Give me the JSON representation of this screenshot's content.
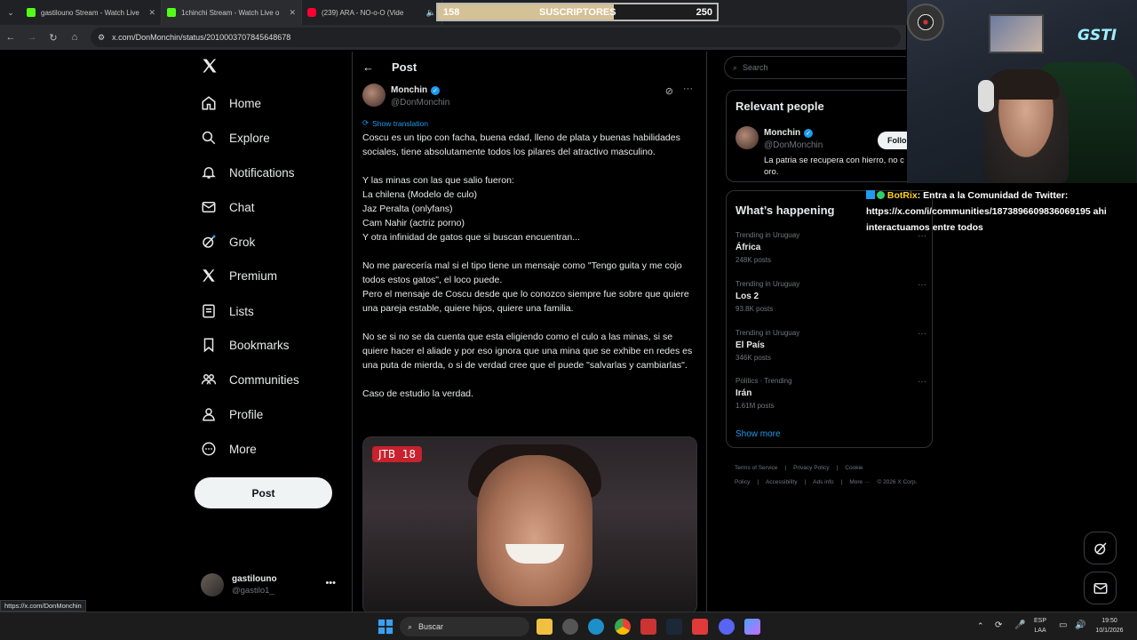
{
  "browser": {
    "tabs": [
      {
        "title": "gastilouno Stream - Watch Live",
        "icon": "kick"
      },
      {
        "title": "1chinchi Stream - Watch Live o",
        "icon": "kick"
      },
      {
        "title": "(239) ARA - NO-o-O (Vide",
        "icon": "youtube"
      }
    ],
    "url": "x.com/DonMonchin/status/2010003707845648678",
    "status_url": "https://x.com/DonMonchin"
  },
  "subs_overlay": {
    "current": "158",
    "label": "SUSCRIPTORES",
    "goal": "250",
    "progress": 0.632
  },
  "nav": {
    "items": [
      {
        "label": "Home",
        "icon": "home-icon"
      },
      {
        "label": "Explore",
        "icon": "search-icon"
      },
      {
        "label": "Notifications",
        "icon": "bell-icon"
      },
      {
        "label": "Chat",
        "icon": "mail-icon"
      },
      {
        "label": "Grok",
        "icon": "grok-icon"
      },
      {
        "label": "Premium",
        "icon": "x-icon"
      },
      {
        "label": "Lists",
        "icon": "list-icon"
      },
      {
        "label": "Bookmarks",
        "icon": "bookmark-icon"
      },
      {
        "label": "Communities",
        "icon": "communities-icon"
      },
      {
        "label": "Profile",
        "icon": "person-icon"
      },
      {
        "label": "More",
        "icon": "more-circle-icon"
      }
    ],
    "post_button": "Post",
    "account": {
      "name": "gastilouno",
      "handle": "@gastilo1_"
    }
  },
  "post": {
    "header": "Post",
    "author_name": "Monchin",
    "author_handle": "@DonMonchin",
    "show_translation": "Show translation",
    "paragraphs": [
      [
        "Coscu es un tipo con facha, buena edad, lleno de plata y buenas habilidades sociales, tiene absolutamente todos los pilares del atractivo masculino."
      ],
      [
        "Y las minas con las que salio fueron:",
        "La chilena (Modelo de culo)",
        "Jaz Peralta (onlyfans)",
        "Cam Nahir (actriz porno)",
        "Y otra infinidad de gatos que si buscan encuentran..."
      ],
      [
        "No me parecería mal si el tipo tiene un mensaje como \"Tengo guita y me cojo todos estos gatos\", el loco puede.",
        "Pero el mensaje de Coscu desde que lo conozco siempre fue sobre que quiere una pareja estable, quiere hijos, quiere una familia."
      ],
      [
        "No se si no se da cuenta que esta eligiendo como el culo a las minas, si se quiere hacer el aliade y por eso ignora que una mina que se exhibe en redes es una puta de mierda, o si de verdad cree que el puede \"salvarlas y cambiarlas\"."
      ],
      [
        "Caso de estudio la verdad."
      ]
    ],
    "media_badge_left": "JTB",
    "media_badge_right": "18"
  },
  "sidebar": {
    "search_placeholder": "Search",
    "relevant": {
      "title": "Relevant people",
      "name": "Monchin",
      "handle": "@DonMonchin",
      "follow": "Follo",
      "bio": "La patria se recupera con hierro, no c oro."
    },
    "happening": {
      "title": "What’s happening",
      "trends": [
        {
          "meta": "Trending in Uruguay",
          "topic": "África",
          "count": "248K posts"
        },
        {
          "meta": "Trending in Uruguay",
          "topic": "Los 2",
          "count": "93.8K posts"
        },
        {
          "meta": "Trending in Uruguay",
          "topic": "El País",
          "count": "346K posts"
        },
        {
          "meta": "Politics · Trending",
          "topic": "Irán",
          "count": "1.61M posts"
        }
      ],
      "show_more": "Show more"
    },
    "footer": [
      "Terms of Service",
      "|",
      "Privacy Policy",
      "|",
      "Cookie Policy",
      "|",
      "Accessibility",
      "|",
      "Ads info",
      "|",
      "More ···",
      "© 2026 X Corp."
    ]
  },
  "overlay": {
    "cam_logo": "GSTI",
    "chat_user": "BotRix",
    "chat_message": ": Entra a la Comunidad de Twitter: https://x.com/i/communities/1873896609836069195 ahi interactuamos entre todos"
  },
  "taskbar": {
    "search": "Buscar",
    "lang_1": "ESP",
    "lang_2": "LAA",
    "time": "19:50",
    "date": "10/1/2026"
  }
}
